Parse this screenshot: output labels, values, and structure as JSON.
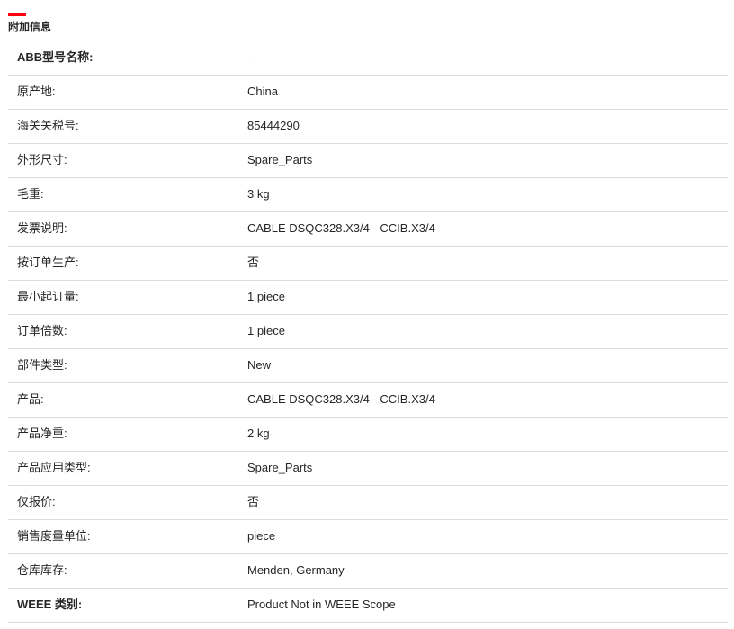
{
  "section": {
    "title": "附加信息",
    "accent_color": "#ff000f"
  },
  "rows": [
    {
      "label": "ABB型号名称:",
      "value": "-"
    },
    {
      "label": "原产地:",
      "value": "China"
    },
    {
      "label": "海关关税号:",
      "value": "85444290"
    },
    {
      "label": "外形尺寸:",
      "value": "Spare_Parts"
    },
    {
      "label": "毛重:",
      "value": "3 kg"
    },
    {
      "label": "发票说明:",
      "value": "CABLE DSQC328.X3/4 - CCIB.X3/4"
    },
    {
      "label": "按订单生产:",
      "value": "否"
    },
    {
      "label": "最小起订量:",
      "value": "1 piece"
    },
    {
      "label": "订单倍数:",
      "value": "1 piece"
    },
    {
      "label": "部件类型:",
      "value": "New"
    },
    {
      "label": "产品:",
      "value": "CABLE DSQC328.X3/4 - CCIB.X3/4"
    },
    {
      "label": "产品净重:",
      "value": "2 kg"
    },
    {
      "label": "产品应用类型:",
      "value": "Spare_Parts"
    },
    {
      "label": "仅报价:",
      "value": "否"
    },
    {
      "label": "销售度量单位:",
      "value": "piece"
    },
    {
      "label": "仓库库存:",
      "value": "Menden, Germany"
    },
    {
      "label": "WEEE 类别:",
      "value": "Product Not in WEEE Scope"
    }
  ]
}
